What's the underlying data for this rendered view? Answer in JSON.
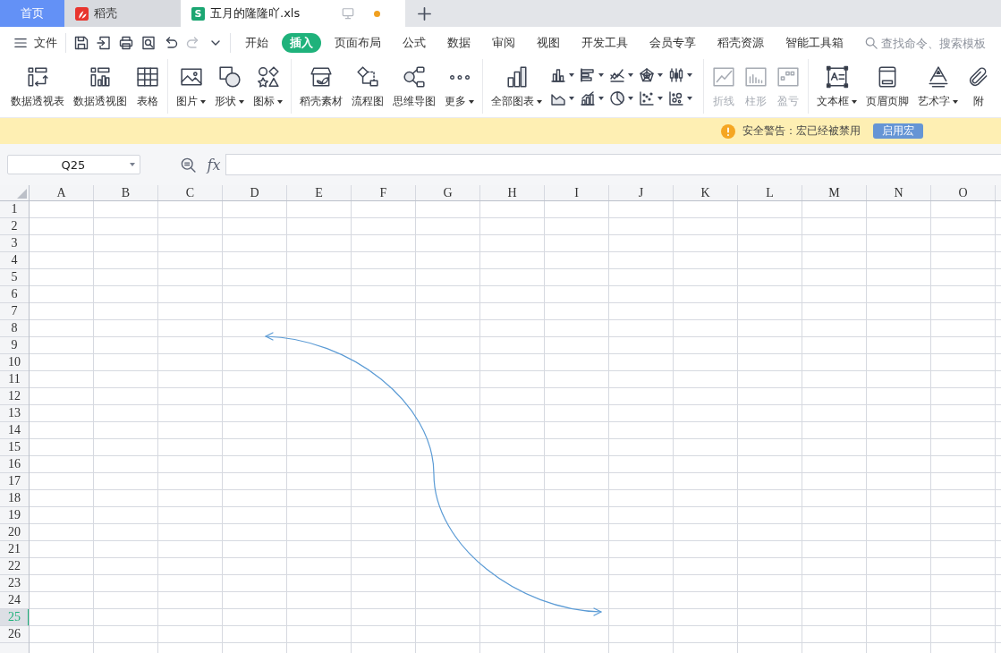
{
  "tabs": [
    {
      "label": "首页",
      "kind": "home",
      "selected": false
    },
    {
      "label": "稻壳",
      "kind": "docer",
      "selected": false
    },
    {
      "label": "五月的隆隆吖.xls",
      "kind": "spreadsheet",
      "logo": "S",
      "selected": true,
      "unsaved": true
    }
  ],
  "file_menu": {
    "label": "文件"
  },
  "quick_actions": [
    {
      "kind": "save",
      "disabled": false
    },
    {
      "kind": "export",
      "disabled": false
    },
    {
      "kind": "print",
      "disabled": false
    },
    {
      "kind": "preview",
      "disabled": false
    },
    {
      "kind": "undo",
      "disabled": false
    },
    {
      "kind": "redo",
      "disabled": true
    },
    {
      "kind": "customize",
      "disabled": false
    }
  ],
  "ribbon_tabs": [
    {
      "label": "开始",
      "selected": false
    },
    {
      "label": "插入",
      "selected": true
    },
    {
      "label": "页面布局",
      "selected": false
    },
    {
      "label": "公式",
      "selected": false
    },
    {
      "label": "数据",
      "selected": false
    },
    {
      "label": "审阅",
      "selected": false
    },
    {
      "label": "视图",
      "selected": false
    },
    {
      "label": "开发工具",
      "selected": false
    },
    {
      "label": "会员专享",
      "selected": false
    },
    {
      "label": "稻壳资源",
      "selected": false
    },
    {
      "label": "智能工具箱",
      "selected": false
    }
  ],
  "search": {
    "placeholder": "查找命令、搜索模板"
  },
  "ribbon_groups": [
    {
      "disabled": false,
      "buttons": [
        {
          "label": "数据透视表",
          "kind": "pivot-table",
          "dropdown": false
        },
        {
          "label": "数据透视图",
          "kind": "pivot-chart",
          "dropdown": false
        },
        {
          "label": "表格",
          "kind": "table",
          "dropdown": false
        }
      ]
    },
    {
      "disabled": false,
      "buttons": [
        {
          "label": "图片",
          "kind": "picture",
          "dropdown": true
        },
        {
          "label": "形状",
          "kind": "shape",
          "dropdown": true
        },
        {
          "label": "图标",
          "kind": "icon-set",
          "dropdown": true
        }
      ]
    },
    {
      "disabled": false,
      "buttons": [
        {
          "label": "稻壳素材",
          "kind": "material",
          "dropdown": false
        },
        {
          "label": "流程图",
          "kind": "flowchart",
          "dropdown": false
        },
        {
          "label": "思维导图",
          "kind": "mindmap",
          "dropdown": false
        },
        {
          "label": "更多",
          "kind": "more",
          "dropdown": true
        }
      ]
    },
    {
      "disabled": false,
      "buttons": [
        {
          "label": "全部图表",
          "kind": "all-charts",
          "dropdown": true
        }
      ],
      "mini_charts": [
        {
          "kind": "column"
        },
        {
          "kind": "bar"
        },
        {
          "kind": "line"
        },
        {
          "kind": "radar"
        },
        {
          "kind": "stock"
        },
        {
          "kind": "area"
        },
        {
          "kind": "combo"
        },
        {
          "kind": "pie"
        },
        {
          "kind": "scatter"
        },
        {
          "kind": "bubble"
        }
      ]
    },
    {
      "disabled": true,
      "buttons": [
        {
          "label": "折线",
          "kind": "spark-line",
          "dropdown": false
        },
        {
          "label": "柱形",
          "kind": "spark-column",
          "dropdown": false
        },
        {
          "label": "盈亏",
          "kind": "win-loss",
          "dropdown": false
        }
      ]
    },
    {
      "disabled": false,
      "buttons": [
        {
          "label": "文本框",
          "kind": "text-box",
          "dropdown": true
        },
        {
          "label": "页眉页脚",
          "kind": "header-footer",
          "dropdown": false
        },
        {
          "label": "艺术字",
          "kind": "art-text",
          "dropdown": true
        },
        {
          "label": "附",
          "kind": "attachment",
          "dropdown": false
        }
      ]
    }
  ],
  "macro_warning": {
    "message": "安全警告：宏已经被禁用",
    "button": "启用宏"
  },
  "formula_bar": {
    "name_box": "Q25",
    "function_label": "fx"
  },
  "sheet": {
    "columns": [
      "A",
      "B",
      "C",
      "D",
      "E",
      "F",
      "G",
      "H",
      "I",
      "J",
      "K",
      "L",
      "M",
      "N",
      "O"
    ],
    "rows": [
      {
        "label": "1",
        "selected": false
      },
      {
        "label": "2",
        "selected": false
      },
      {
        "label": "3",
        "selected": false
      },
      {
        "label": "4",
        "selected": false
      },
      {
        "label": "5",
        "selected": false
      },
      {
        "label": "6",
        "selected": false
      },
      {
        "label": "7",
        "selected": false
      },
      {
        "label": "8",
        "selected": false
      },
      {
        "label": "9",
        "selected": false
      },
      {
        "label": "10",
        "selected": false
      },
      {
        "label": "11",
        "selected": false
      },
      {
        "label": "12",
        "selected": false
      },
      {
        "label": "13",
        "selected": false
      },
      {
        "label": "14",
        "selected": false
      },
      {
        "label": "15",
        "selected": false
      },
      {
        "label": "16",
        "selected": false
      },
      {
        "label": "17",
        "selected": false
      },
      {
        "label": "18",
        "selected": false
      },
      {
        "label": "19",
        "selected": false
      },
      {
        "label": "20",
        "selected": false
      },
      {
        "label": "21",
        "selected": false
      },
      {
        "label": "22",
        "selected": false
      },
      {
        "label": "23",
        "selected": false
      },
      {
        "label": "24",
        "selected": false
      },
      {
        "label": "25",
        "selected": true
      },
      {
        "label": "26",
        "selected": false
      }
    ],
    "shapes": [
      {
        "kind": "curved-double-arrow"
      }
    ]
  }
}
